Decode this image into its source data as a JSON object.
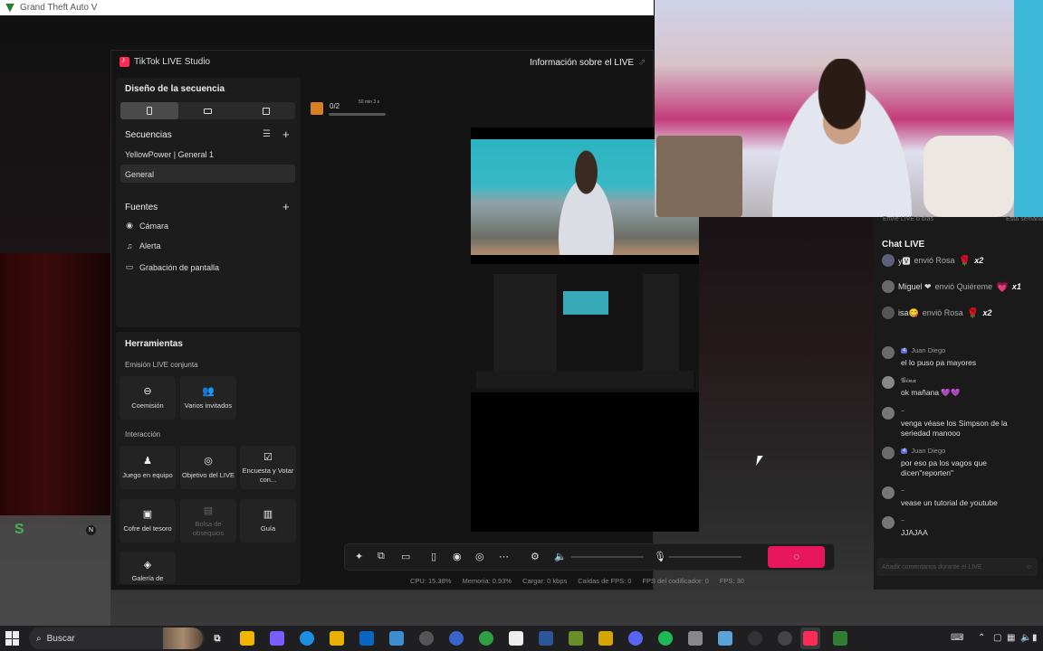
{
  "game": {
    "title": "Grand Theft Auto V",
    "minimap_letter": "S",
    "compass": "N"
  },
  "studio": {
    "title": "TikTok LIVE Studio",
    "info_live": "Información sobre el LIVE",
    "scene_design": "Diseño de la secuencia",
    "scenes_label": "Secuencias",
    "scenes": [
      "YellowPower | General 1",
      "General"
    ],
    "sources_label": "Fuentes",
    "sources": [
      {
        "label": "Cámara",
        "icon": "camera-icon"
      },
      {
        "label": "Alerta",
        "icon": "bell-icon"
      },
      {
        "label": "Grabación de pantalla",
        "icon": "monitor-icon"
      }
    ],
    "tools_label": "Herramientas",
    "coop_label": "Emisión LIVE conjunta",
    "coop_tools": [
      "Coemisión",
      "Varios invitados"
    ],
    "interaction_label": "Interacción",
    "interaction_tools": [
      "Juego en equipo",
      "Objetivo del LIVE",
      "Encuesta y Votar con...",
      "Cofre del tesoro",
      "Bolsa de obsequios",
      "Guía",
      "Galería de"
    ],
    "goal": {
      "count": "0/2",
      "time": "50 min 3 s",
      "progress": 0
    },
    "live_button_icon": "loading-icon",
    "stats": {
      "cpu": "CPU: 15.38%",
      "memory": "Memoria: 0.93%",
      "upload": "Cargar: 0 kbps",
      "fps_drops": "Caídas de FPS: 0",
      "encoder_fps": "FPS del codificador: 0",
      "fps": "FPS: 30"
    }
  },
  "chat": {
    "top_left": "Envíe LIVE 6 días",
    "top_right": "Esta semana",
    "title": "Chat LIVE",
    "gifts": [
      {
        "user": "y🆅",
        "action": "envió Rosa",
        "mult": "x2"
      },
      {
        "user": "Miguel ❤",
        "action": "envió Quiéreme",
        "mult": "x1"
      },
      {
        "user": "isa😋",
        "action": "envió Rosa",
        "mult": "x2"
      }
    ],
    "messages": [
      {
        "level": "4",
        "user": "Juan Diego",
        "text": "el lo puso pa mayores"
      },
      {
        "level": "",
        "user": "𝓖𝓲𝓷𝓪",
        "text": "ok mañana 💜💜"
      },
      {
        "level": "",
        "user": "~",
        "text": "venga véase los Simpson de la seriedad manooo"
      },
      {
        "level": "4",
        "user": "Juan Diego",
        "text": "por eso pa los vagos que dicen\"reporten\""
      },
      {
        "level": "",
        "user": "~",
        "text": "vease un tutorial de youtube"
      },
      {
        "level": "",
        "user": "~",
        "text": "JJAJAA"
      }
    ],
    "input_placeholder": "Añadir comentarios durante el LIVE"
  },
  "taskbar": {
    "search_label": "Buscar"
  }
}
